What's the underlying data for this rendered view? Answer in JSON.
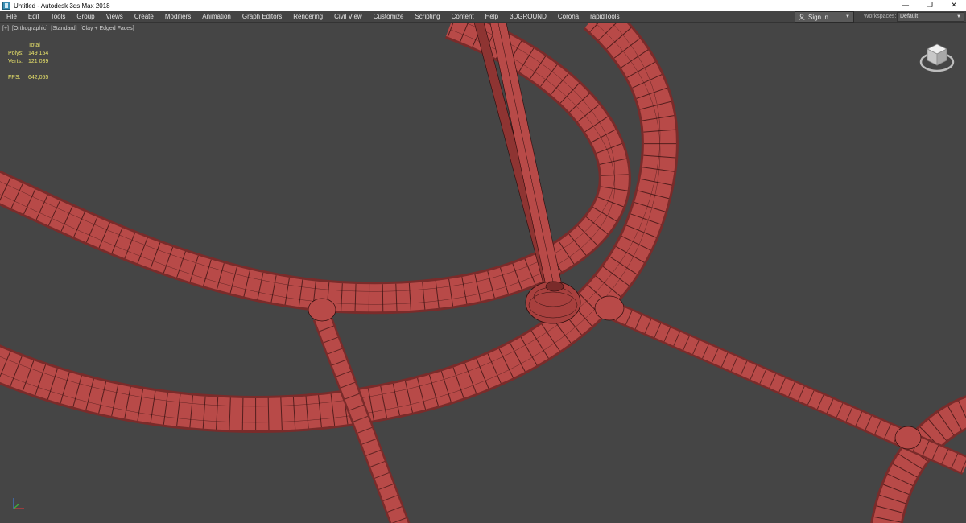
{
  "window": {
    "title": "Untitled - Autodesk 3ds Max 2018",
    "controls": [
      "—",
      "❐",
      "✕"
    ]
  },
  "menu": {
    "items": [
      "File",
      "Edit",
      "Tools",
      "Group",
      "Views",
      "Create",
      "Modifiers",
      "Animation",
      "Graph Editors",
      "Rendering",
      "Civil View",
      "Customize",
      "Scripting",
      "Content",
      "Help",
      "3DGROUND",
      "Corona",
      "rapidTools"
    ],
    "sign_in": "Sign In",
    "workspaces_label": "Workspaces:",
    "workspace_value": "Default"
  },
  "viewport": {
    "labels": [
      "[+]",
      "[Orthographic]",
      "[Standard]",
      "[Clay + Edged Faces]"
    ],
    "stats": {
      "total_label": "Total",
      "polys_label": "Polys:",
      "polys_value": "149 154",
      "verts_label": "Verts:",
      "verts_value": "121 039",
      "fps_label": "FPS:",
      "fps_value": "642,055"
    }
  },
  "colors": {
    "viewport_bg": "#454545",
    "tube_fill": "#b84a48",
    "tube_shade": "#8e3432",
    "wire": "#2a0c0c",
    "stats_text": "#e8e26a"
  }
}
